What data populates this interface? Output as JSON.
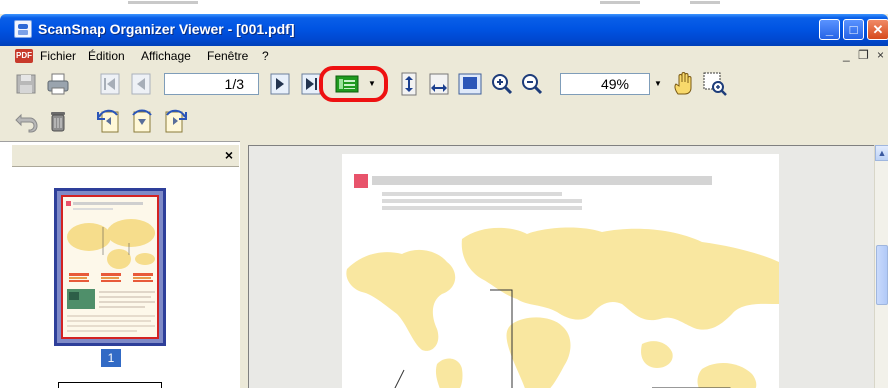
{
  "window": {
    "title": "ScanSnap Organizer Viewer - [001.pdf]"
  },
  "menu": {
    "badge": "PDF",
    "items": [
      "Fichier",
      "Édition",
      "Affichage",
      "Fenêtre",
      "?"
    ],
    "mdi_minimize": "_",
    "mdi_restore": "❐",
    "mdi_close": "×"
  },
  "toolbar": {
    "page_indicator": "1/3",
    "zoom_level": "49%",
    "view_mode_highlighted": true
  },
  "thumbnail_pane": {
    "close_label": "×",
    "pages": [
      {
        "number": "1",
        "selected": true
      }
    ]
  },
  "document": {
    "file": "001.pdf",
    "accent_color": "#e8536b",
    "map_color": "#f9e7a0"
  },
  "colors": {
    "titlebar": "#0054e3",
    "highlight": "#ee1111",
    "selection": "#316ac5"
  }
}
